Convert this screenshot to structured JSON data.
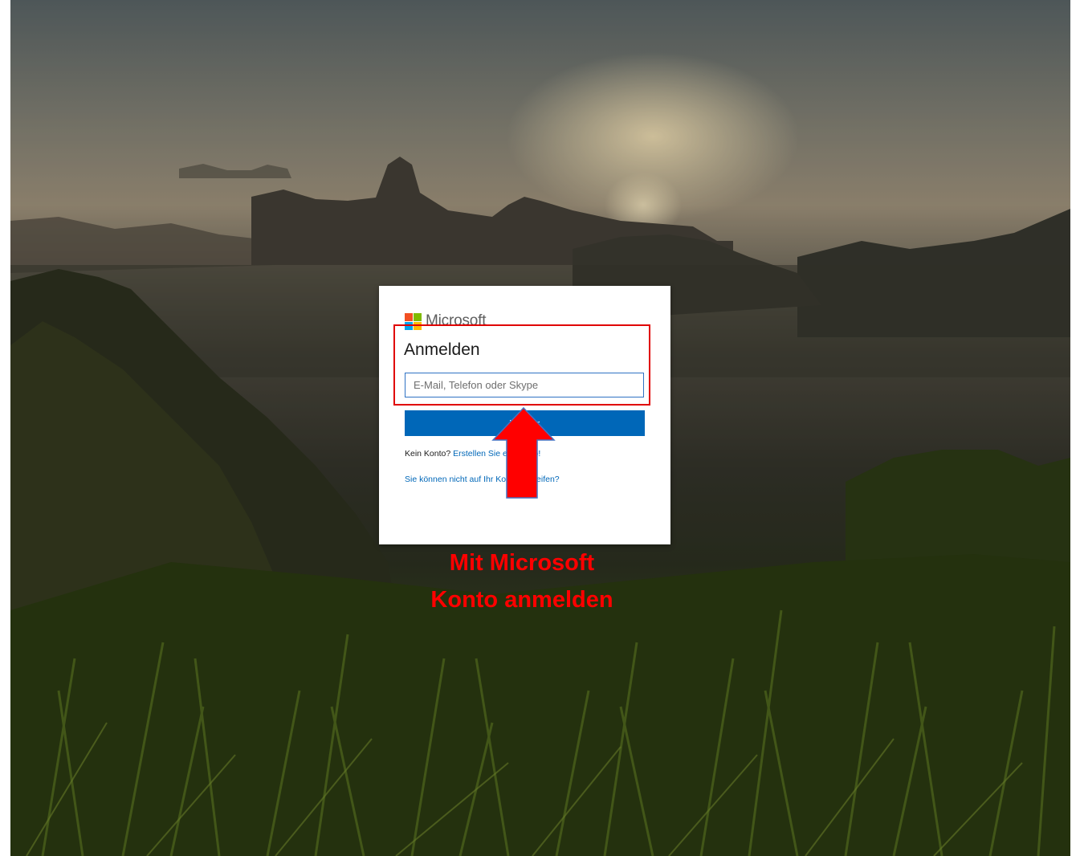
{
  "card": {
    "brand": "Microsoft",
    "heading": "Anmelden",
    "email_placeholder": "E-Mail, Telefon oder Skype",
    "next_button": "Weiter",
    "no_account_prefix": "Kein Konto?",
    "create_link": "Erstellen Sie ein Konto!",
    "cant_access_link": "Sie können nicht auf Ihr Konto zugreifen?"
  },
  "annotation": {
    "caption_line1": "Mit Microsoft",
    "caption_line2": "Konto anmelden",
    "color": "#ff0000"
  },
  "logo_colors": [
    "#f25022",
    "#7fba00",
    "#00a4ef",
    "#ffb900"
  ],
  "accent": "#0067b8"
}
